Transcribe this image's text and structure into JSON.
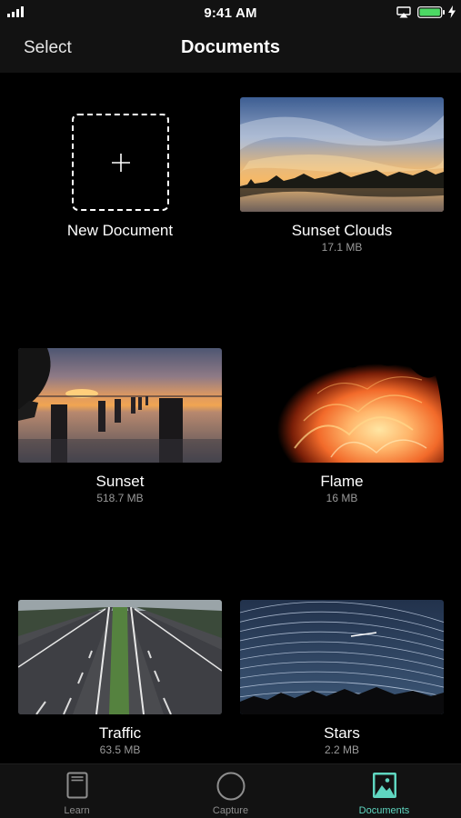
{
  "status_bar": {
    "time": "9:41 AM",
    "icons": [
      "signal-icon",
      "airplay-icon",
      "battery-icon",
      "charging-icon"
    ],
    "battery_color": "#4cd964"
  },
  "nav": {
    "left_button": "Select",
    "title": "Documents"
  },
  "documents": [
    {
      "name": "New Document",
      "size": "",
      "icon": "plus-icon"
    },
    {
      "name": "Sunset Clouds",
      "size": "17.1 MB"
    },
    {
      "name": "Sunset",
      "size": "518.7 MB"
    },
    {
      "name": "Flame",
      "size": "16 MB"
    },
    {
      "name": "Traffic",
      "size": "63.5 MB"
    },
    {
      "name": "Stars",
      "size": "2.2 MB"
    }
  ],
  "tab_bar": {
    "items": [
      {
        "label": "Learn",
        "icon": "book-icon",
        "active": false
      },
      {
        "label": "Capture",
        "icon": "circle-icon",
        "active": false
      },
      {
        "label": "Documents",
        "icon": "photo-icon",
        "active": true
      }
    ],
    "active_color": "#5fd6c0",
    "inactive_color": "#8e8e8e"
  }
}
